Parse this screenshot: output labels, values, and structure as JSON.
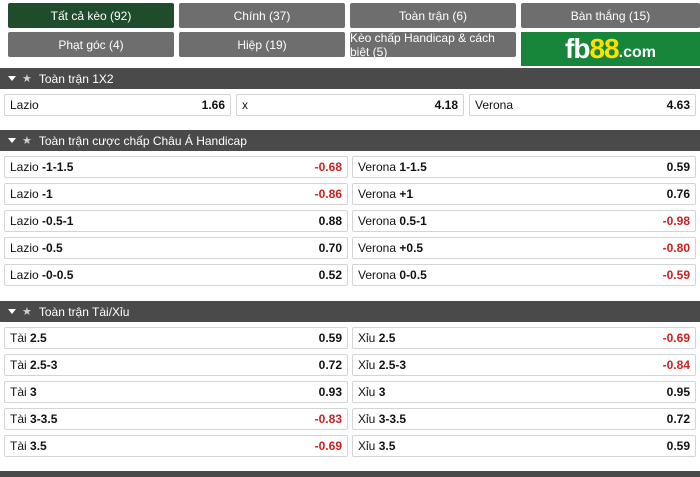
{
  "tabs": [
    {
      "label": "Tất cả kèo (92)",
      "active": true
    },
    {
      "label": "Chính (37)",
      "active": false
    },
    {
      "label": "Toàn trận (6)",
      "active": false
    },
    {
      "label": "Bàn thắng (15)",
      "active": false
    },
    {
      "label": "Phạt góc (4)",
      "active": false
    },
    {
      "label": "Hiệp (19)",
      "active": false
    },
    {
      "label": "Kèo chấp Handicap & cách biệt (5)",
      "active": false
    }
  ],
  "logo": {
    "part1": "fb",
    "part2": "88",
    "part3": ".com",
    "accent": "#ffe100",
    "bg": "#17863a"
  },
  "sections": {
    "s1x2": {
      "title": "Toàn trận 1X2",
      "cells": [
        {
          "label": "Lazio",
          "odd": "1.66"
        },
        {
          "label": "x",
          "odd": "4.18"
        },
        {
          "label": "Verona",
          "odd": "4.63"
        }
      ]
    },
    "handicap": {
      "title": "Toàn trận cược chấp Châu Á Handicap",
      "rows": [
        {
          "l_team": "Lazio",
          "l_line": "-1-1.5",
          "l_odd": "-0.68",
          "r_team": "Verona",
          "r_line": "1-1.5",
          "r_odd": "0.59"
        },
        {
          "l_team": "Lazio",
          "l_line": "-1",
          "l_odd": "-0.86",
          "r_team": "Verona",
          "r_line": "+1",
          "r_odd": "0.76"
        },
        {
          "l_team": "Lazio",
          "l_line": "-0.5-1",
          "l_odd": "0.88",
          "r_team": "Verona",
          "r_line": "0.5-1",
          "r_odd": "-0.98"
        },
        {
          "l_team": "Lazio",
          "l_line": "-0.5",
          "l_odd": "0.70",
          "r_team": "Verona",
          "r_line": "+0.5",
          "r_odd": "-0.80"
        },
        {
          "l_team": "Lazio",
          "l_line": "-0-0.5",
          "l_odd": "0.52",
          "r_team": "Verona",
          "r_line": "0-0.5",
          "r_odd": "-0.59"
        }
      ]
    },
    "overunder": {
      "title": "Toàn trận Tài/Xỉu",
      "rows": [
        {
          "l_team": "Tài",
          "l_line": "2.5",
          "l_odd": "0.59",
          "r_team": "Xỉu",
          "r_line": "2.5",
          "r_odd": "-0.69"
        },
        {
          "l_team": "Tài",
          "l_line": "2.5-3",
          "l_odd": "0.72",
          "r_team": "Xỉu",
          "r_line": "2.5-3",
          "r_odd": "-0.84"
        },
        {
          "l_team": "Tài",
          "l_line": "3",
          "l_odd": "0.93",
          "r_team": "Xỉu",
          "r_line": "3",
          "r_odd": "0.95"
        },
        {
          "l_team": "Tài",
          "l_line": "3-3.5",
          "l_odd": "-0.83",
          "r_team": "Xỉu",
          "r_line": "3-3.5",
          "r_odd": "0.72"
        },
        {
          "l_team": "Tài",
          "l_line": "3.5",
          "l_odd": "-0.69",
          "r_team": "Xỉu",
          "r_line": "3.5",
          "r_odd": "0.59"
        }
      ]
    }
  },
  "colors": {
    "active_tab": "#1f4d2c",
    "tab": "#6e6e6e",
    "header": "#4a4a4a",
    "negative": "#cc1f1f"
  }
}
